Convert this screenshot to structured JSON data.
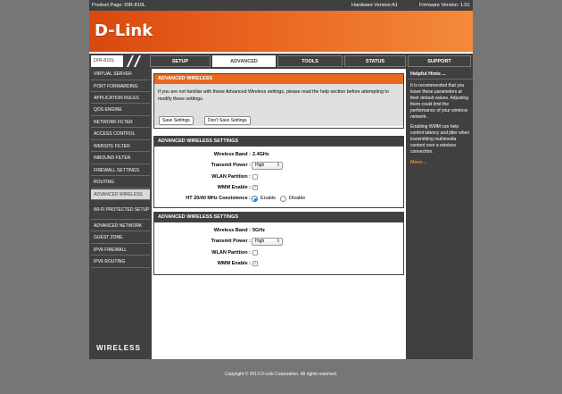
{
  "infobar": {
    "product_page": "Product Page: DIR-810L",
    "hardware_version": "Hardware Version:A1",
    "firmware_version": "Firmware Version: 1.01"
  },
  "brand": {
    "logo": "D-Link",
    "accent_color": "#e9681e",
    "chrome_color": "#404040"
  },
  "nav": {
    "model": "DIR-810L",
    "tabs": [
      {
        "label": "SETUP",
        "active": false
      },
      {
        "label": "ADVANCED",
        "active": true
      },
      {
        "label": "TOOLS",
        "active": false
      },
      {
        "label": "STATUS",
        "active": false
      },
      {
        "label": "SUPPORT",
        "active": false
      }
    ]
  },
  "sidebar": {
    "items": [
      {
        "label": "VIRTUAL SERVER"
      },
      {
        "label": "PORT FORWARDING"
      },
      {
        "label": "APPLICATION RULES"
      },
      {
        "label": "QOS ENGINE"
      },
      {
        "label": "NETWORK FILTER"
      },
      {
        "label": "ACCESS CONTROL"
      },
      {
        "label": "WEBSITE FILTER"
      },
      {
        "label": "INBOUND FILTER"
      },
      {
        "label": "FIREWALL SETTINGS"
      },
      {
        "label": "ROUTING"
      },
      {
        "label": "ADVANCED WIRELESS",
        "active": true
      },
      {
        "label": "WI-FI PROTECTED SETUP"
      },
      {
        "label": "ADVANCED NETWORK"
      },
      {
        "label": "GUEST ZONE"
      },
      {
        "label": "IPV6 FIREWALL"
      },
      {
        "label": "IPV6 ROUTING"
      }
    ],
    "footer_logo": "WIRELESS"
  },
  "main": {
    "intro": {
      "title": "ADVANCED WIRELESS",
      "text": "If you are not familiar with these Advanced Wireless settings, please read the help section before attempting to modify these settings.",
      "save_label": "Save Settings",
      "dont_save_label": "Don't Save Settings"
    },
    "band1": {
      "title": "ADVANCED WIRELESS SETTINGS",
      "wireless_band_label": "Wireless Band :",
      "wireless_band_value": "2.4GHz",
      "transmit_power_label": "Transmit Power :",
      "transmit_power_value": "High",
      "wlan_partition_label": "WLAN Partition :",
      "wlan_partition_checked": false,
      "wmm_enable_label": "WMM Enable :",
      "wmm_enable_checked": true,
      "coexistence_label": "HT 20/40 MHz Coexistence :",
      "coexistence_enable": "Enable",
      "coexistence_disable": "Disable",
      "coexistence_selected": "Enable"
    },
    "band2": {
      "title": "ADVANCED WIRELESS SETTINGS",
      "wireless_band_label": "Wireless Band :",
      "wireless_band_value": "5GHz",
      "transmit_power_label": "Transmit Power :",
      "transmit_power_value": "High",
      "wlan_partition_label": "WLAN Partition :",
      "wlan_partition_checked": false,
      "wmm_enable_label": "WMM Enable :",
      "wmm_enable_checked": true
    }
  },
  "hints": {
    "title": "Helpful Hints ...",
    "p1": "It is recommended that you leave these parameters at their default values. Adjusting them could limit the performance of your wireless network.",
    "p2": "Enabling WMM can help control latency and jitter when transmitting multimedia content over a wireless connection.",
    "more": "More..."
  },
  "footer": {
    "copyright": "Copyright © 2013 D-Link Corporation. All rights reserved."
  }
}
